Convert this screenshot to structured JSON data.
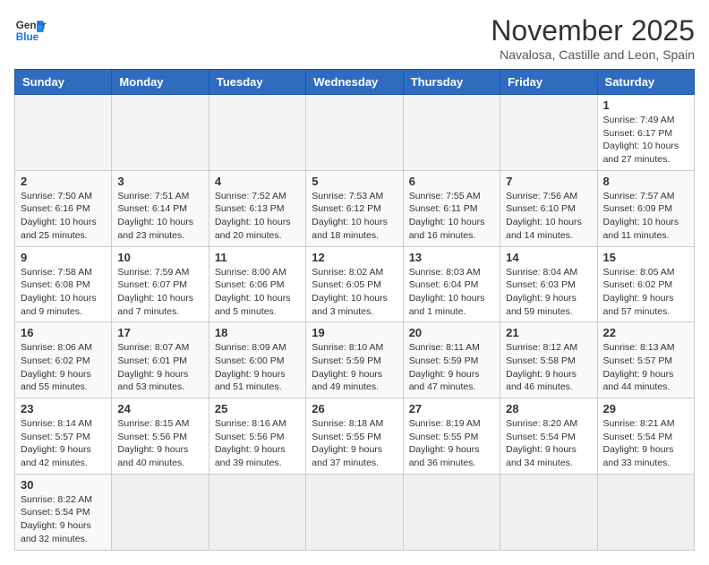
{
  "logo": {
    "general": "General",
    "blue": "Blue"
  },
  "title": "November 2025",
  "subtitle": "Navalosa, Castille and Leon, Spain",
  "days_of_week": [
    "Sunday",
    "Monday",
    "Tuesday",
    "Wednesday",
    "Thursday",
    "Friday",
    "Saturday"
  ],
  "weeks": [
    [
      {
        "day": "",
        "info": ""
      },
      {
        "day": "",
        "info": ""
      },
      {
        "day": "",
        "info": ""
      },
      {
        "day": "",
        "info": ""
      },
      {
        "day": "",
        "info": ""
      },
      {
        "day": "",
        "info": ""
      },
      {
        "day": "1",
        "info": "Sunrise: 7:49 AM\nSunset: 6:17 PM\nDaylight: 10 hours and 27 minutes."
      }
    ],
    [
      {
        "day": "2",
        "info": "Sunrise: 7:50 AM\nSunset: 6:16 PM\nDaylight: 10 hours and 25 minutes."
      },
      {
        "day": "3",
        "info": "Sunrise: 7:51 AM\nSunset: 6:14 PM\nDaylight: 10 hours and 23 minutes."
      },
      {
        "day": "4",
        "info": "Sunrise: 7:52 AM\nSunset: 6:13 PM\nDaylight: 10 hours and 20 minutes."
      },
      {
        "day": "5",
        "info": "Sunrise: 7:53 AM\nSunset: 6:12 PM\nDaylight: 10 hours and 18 minutes."
      },
      {
        "day": "6",
        "info": "Sunrise: 7:55 AM\nSunset: 6:11 PM\nDaylight: 10 hours and 16 minutes."
      },
      {
        "day": "7",
        "info": "Sunrise: 7:56 AM\nSunset: 6:10 PM\nDaylight: 10 hours and 14 minutes."
      },
      {
        "day": "8",
        "info": "Sunrise: 7:57 AM\nSunset: 6:09 PM\nDaylight: 10 hours and 11 minutes."
      }
    ],
    [
      {
        "day": "9",
        "info": "Sunrise: 7:58 AM\nSunset: 6:08 PM\nDaylight: 10 hours and 9 minutes."
      },
      {
        "day": "10",
        "info": "Sunrise: 7:59 AM\nSunset: 6:07 PM\nDaylight: 10 hours and 7 minutes."
      },
      {
        "day": "11",
        "info": "Sunrise: 8:00 AM\nSunset: 6:06 PM\nDaylight: 10 hours and 5 minutes."
      },
      {
        "day": "12",
        "info": "Sunrise: 8:02 AM\nSunset: 6:05 PM\nDaylight: 10 hours and 3 minutes."
      },
      {
        "day": "13",
        "info": "Sunrise: 8:03 AM\nSunset: 6:04 PM\nDaylight: 10 hours and 1 minute."
      },
      {
        "day": "14",
        "info": "Sunrise: 8:04 AM\nSunset: 6:03 PM\nDaylight: 9 hours and 59 minutes."
      },
      {
        "day": "15",
        "info": "Sunrise: 8:05 AM\nSunset: 6:02 PM\nDaylight: 9 hours and 57 minutes."
      }
    ],
    [
      {
        "day": "16",
        "info": "Sunrise: 8:06 AM\nSunset: 6:02 PM\nDaylight: 9 hours and 55 minutes."
      },
      {
        "day": "17",
        "info": "Sunrise: 8:07 AM\nSunset: 6:01 PM\nDaylight: 9 hours and 53 minutes."
      },
      {
        "day": "18",
        "info": "Sunrise: 8:09 AM\nSunset: 6:00 PM\nDaylight: 9 hours and 51 minutes."
      },
      {
        "day": "19",
        "info": "Sunrise: 8:10 AM\nSunset: 5:59 PM\nDaylight: 9 hours and 49 minutes."
      },
      {
        "day": "20",
        "info": "Sunrise: 8:11 AM\nSunset: 5:59 PM\nDaylight: 9 hours and 47 minutes."
      },
      {
        "day": "21",
        "info": "Sunrise: 8:12 AM\nSunset: 5:58 PM\nDaylight: 9 hours and 46 minutes."
      },
      {
        "day": "22",
        "info": "Sunrise: 8:13 AM\nSunset: 5:57 PM\nDaylight: 9 hours and 44 minutes."
      }
    ],
    [
      {
        "day": "23",
        "info": "Sunrise: 8:14 AM\nSunset: 5:57 PM\nDaylight: 9 hours and 42 minutes."
      },
      {
        "day": "24",
        "info": "Sunrise: 8:15 AM\nSunset: 5:56 PM\nDaylight: 9 hours and 40 minutes."
      },
      {
        "day": "25",
        "info": "Sunrise: 8:16 AM\nSunset: 5:56 PM\nDaylight: 9 hours and 39 minutes."
      },
      {
        "day": "26",
        "info": "Sunrise: 8:18 AM\nSunset: 5:55 PM\nDaylight: 9 hours and 37 minutes."
      },
      {
        "day": "27",
        "info": "Sunrise: 8:19 AM\nSunset: 5:55 PM\nDaylight: 9 hours and 36 minutes."
      },
      {
        "day": "28",
        "info": "Sunrise: 8:20 AM\nSunset: 5:54 PM\nDaylight: 9 hours and 34 minutes."
      },
      {
        "day": "29",
        "info": "Sunrise: 8:21 AM\nSunset: 5:54 PM\nDaylight: 9 hours and 33 minutes."
      }
    ],
    [
      {
        "day": "30",
        "info": "Sunrise: 8:22 AM\nSunset: 5:54 PM\nDaylight: 9 hours and 32 minutes."
      },
      {
        "day": "",
        "info": ""
      },
      {
        "day": "",
        "info": ""
      },
      {
        "day": "",
        "info": ""
      },
      {
        "day": "",
        "info": ""
      },
      {
        "day": "",
        "info": ""
      },
      {
        "day": "",
        "info": ""
      }
    ]
  ]
}
